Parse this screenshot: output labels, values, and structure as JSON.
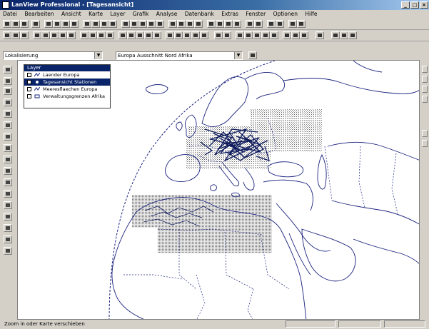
{
  "window": {
    "title": "LanView Professional - [Tagesansicht]"
  },
  "menu": [
    "Datei",
    "Bearbeiten",
    "Ansicht",
    "Karte",
    "Layer",
    "Grafik",
    "Analyse",
    "Datenbank",
    "Extras",
    "Fenster",
    "Optionen",
    "Hilfe"
  ],
  "toolbar": {
    "layer_combo": "Lokalisierung",
    "view_combo": "Europa Ausschnitt Nord Afrika"
  },
  "layers_panel": {
    "title": "Layer",
    "items": [
      {
        "name": "Laender Europa",
        "visible": true,
        "selected": false
      },
      {
        "name": "Tagesansicht Stationen",
        "visible": false,
        "selected": true
      },
      {
        "name": "Meeresflaechen Europa",
        "visible": true,
        "selected": false
      },
      {
        "name": "Verwaltungsgrenzen Afrika",
        "visible": true,
        "selected": false
      }
    ]
  },
  "status": {
    "text": "Zoom in oder Karte verschieben"
  },
  "colors": {
    "map_outline": "#1a237e",
    "selection": "#0a246a",
    "hatch": "#555555"
  }
}
